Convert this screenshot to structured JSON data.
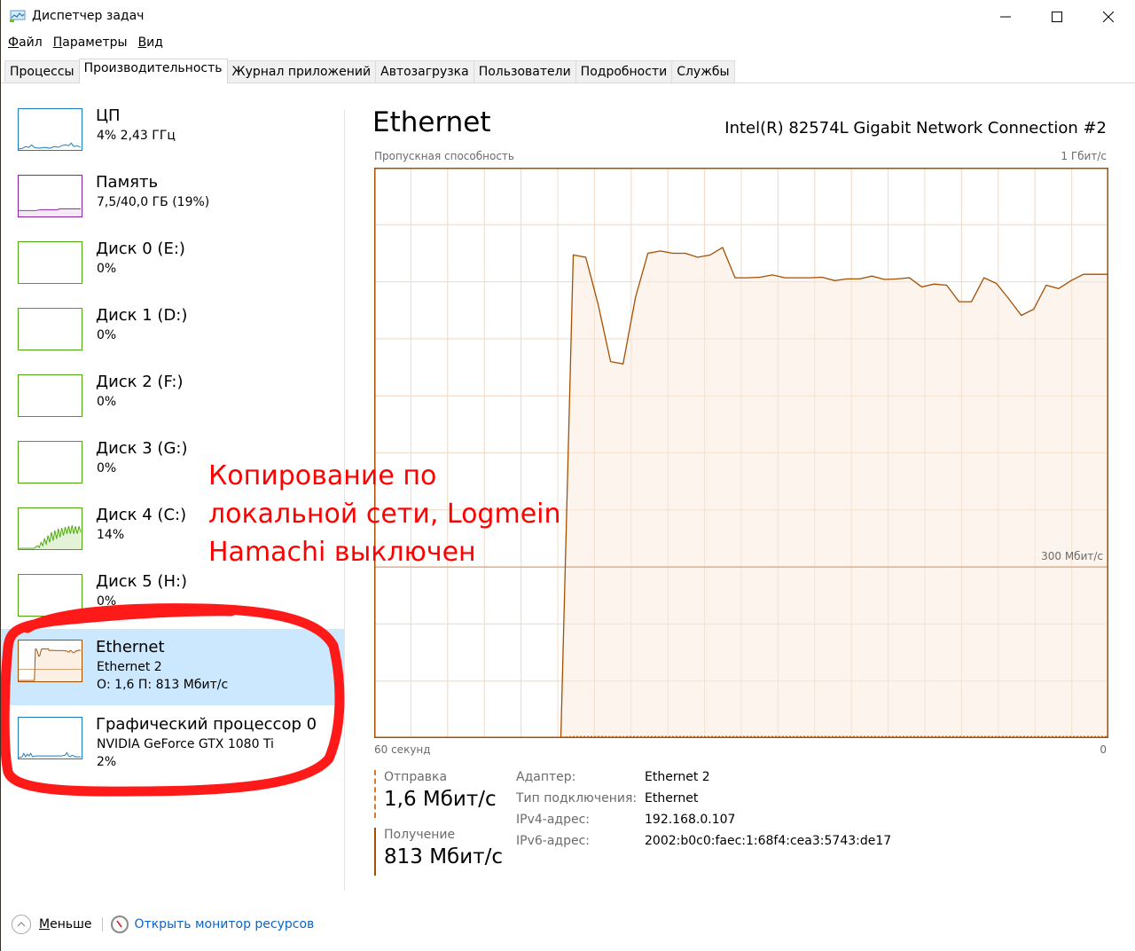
{
  "window": {
    "title": "Диспетчер задач",
    "controls": {
      "minimize": "minimize",
      "maximize": "maximize",
      "close": "close"
    }
  },
  "menu": [
    {
      "accel": "Ф",
      "rest": "айл"
    },
    {
      "accel": "П",
      "rest": "араметры"
    },
    {
      "accel": "В",
      "rest": "ид"
    }
  ],
  "tabs": [
    {
      "label": "Процессы",
      "active": false
    },
    {
      "label": "Производительность",
      "active": true
    },
    {
      "label": "Журнал приложений",
      "active": false
    },
    {
      "label": "Автозагрузка",
      "active": false
    },
    {
      "label": "Пользователи",
      "active": false
    },
    {
      "label": "Подробности",
      "active": false
    },
    {
      "label": "Службы",
      "active": false
    }
  ],
  "sidebar": {
    "items": [
      {
        "title": "ЦП",
        "line1": "4% 2,43 ГГц",
        "line2": "",
        "color": "#1b7bbd",
        "kind": "cpu"
      },
      {
        "title": "Память",
        "line1": "7,5/40,0 ГБ (19%)",
        "line2": "",
        "color": "#8b1fa8",
        "kind": "memory"
      },
      {
        "title": "Диск 0 (E:)",
        "line1": "0%",
        "line2": "",
        "color": "#4da60c",
        "kind": "disk"
      },
      {
        "title": "Диск 1 (D:)",
        "line1": "0%",
        "line2": "",
        "color": "#4da60c",
        "kind": "disk"
      },
      {
        "title": "Диск 2 (F:)",
        "line1": "0%",
        "line2": "",
        "color": "#4da60c",
        "kind": "disk"
      },
      {
        "title": "Диск 3 (G:)",
        "line1": "0%",
        "line2": "",
        "color": "#4da60c",
        "kind": "disk"
      },
      {
        "title": "Диск 4 (C:)",
        "line1": "14%",
        "line2": "",
        "color": "#4da60c",
        "kind": "disk-active"
      },
      {
        "title": "Диск 5 (H:)",
        "line1": "0%",
        "line2": "",
        "color": "#4da60c",
        "kind": "disk"
      },
      {
        "title": "Ethernet",
        "line1": "Ethernet 2",
        "line2": "О: 1,6 П: 813 Мбит/с",
        "color": "#a74f01",
        "kind": "ethernet",
        "selected": true
      },
      {
        "title": "Графический процессор 0",
        "line1": "NVIDIA GeForce GTX 1080 Ti",
        "line2": "2%",
        "color": "#1b7bbd",
        "kind": "gpu"
      }
    ]
  },
  "main": {
    "title": "Ethernet",
    "adapter": "Intel(R) 82574L Gigabit Network Connection #2",
    "chart_top_left": "Пропускная способность",
    "chart_top_right": "1 Гбит/с",
    "chart_bottom_left": "60 секунд",
    "chart_bottom_right": "0",
    "chart_mid_label": "300 Мбит/с"
  },
  "chart_data": {
    "type": "area",
    "title": "Пропускная способность",
    "xlabel": "60 секунд",
    "ylabel": "",
    "x_unit": "seconds ago",
    "xlim": [
      60,
      0
    ],
    "ylim": [
      0,
      1000
    ],
    "y_unit": "Мбит/с",
    "grid": true,
    "reference_line": {
      "value": 300,
      "label": "300 Мбит/с"
    },
    "series": [
      {
        "name": "Получение",
        "style": "solid",
        "color": "#a74f01",
        "fill": "#fcf3eb",
        "values": [
          0,
          0,
          0,
          0,
          0,
          0,
          0,
          0,
          0,
          0,
          0,
          0,
          0,
          0,
          0,
          0,
          847,
          843,
          760,
          660,
          656,
          773,
          850,
          854,
          850,
          850,
          843,
          847,
          860,
          807,
          807,
          808,
          812,
          807,
          807,
          807,
          808,
          802,
          805,
          805,
          810,
          804,
          805,
          807,
          791,
          796,
          794,
          765,
          765,
          807,
          797,
          770,
          741,
          752,
          794,
          788,
          802,
          813,
          813,
          813
        ]
      },
      {
        "name": "Отправка",
        "style": "dashed",
        "color": "#a74f01",
        "values": [
          0,
          0,
          0,
          0,
          0,
          0,
          0,
          0,
          0,
          0,
          0,
          0,
          0,
          0,
          0,
          0,
          1.6,
          1.6,
          1.5,
          1.4,
          1.4,
          1.5,
          1.6,
          1.6,
          1.6,
          1.6,
          1.6,
          1.6,
          1.6,
          1.6,
          1.6,
          1.6,
          1.6,
          1.6,
          1.6,
          1.6,
          1.6,
          1.6,
          1.6,
          1.6,
          1.6,
          1.6,
          1.6,
          1.6,
          1.6,
          1.6,
          1.6,
          1.5,
          1.5,
          1.6,
          1.6,
          1.5,
          1.5,
          1.5,
          1.6,
          1.6,
          1.6,
          1.6,
          1.6,
          1.6
        ]
      }
    ]
  },
  "stats": {
    "send": {
      "label": "Отправка",
      "value": "1,6 Мбит/с"
    },
    "receive": {
      "label": "Получение",
      "value": "813 Мбит/с"
    }
  },
  "properties": [
    {
      "key": "Адаптер:",
      "value": "Ethernet 2"
    },
    {
      "key": "Тип подключения:",
      "value": "Ethernet"
    },
    {
      "key": "IPv4-адрес:",
      "value": "192.168.0.107"
    },
    {
      "key": "IPv6-адрес:",
      "value": "2002:b0c0:faec:1:68f4:cea3:5743:de17"
    }
  ],
  "footer": {
    "less": {
      "accel": "М",
      "rest": "еньше"
    },
    "resmon": "Открыть монитор ресурсов"
  },
  "annotation": {
    "lines": [
      "Копирование по",
      "локальной сети, Logmein",
      "Hamachi выключен"
    ],
    "color": "#ff0000"
  }
}
